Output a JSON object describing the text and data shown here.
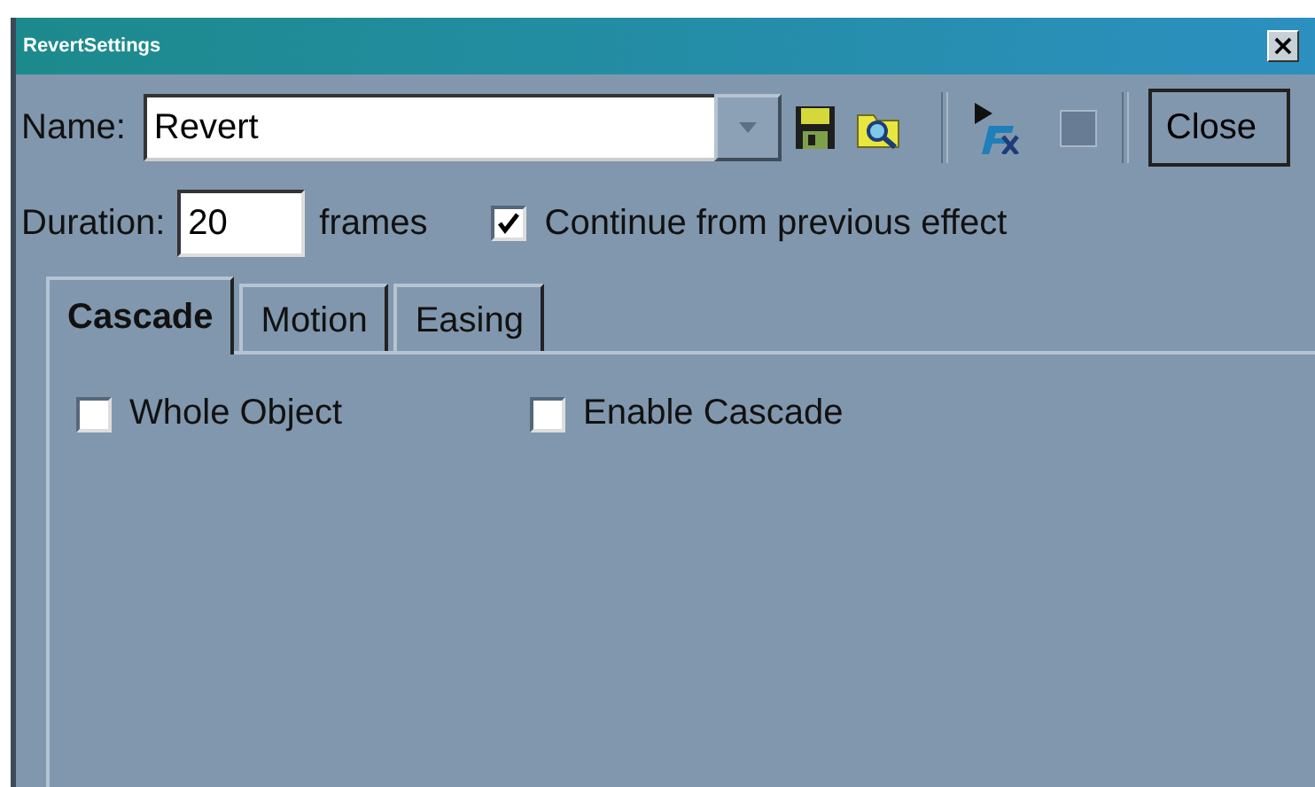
{
  "window": {
    "title": "RevertSettings",
    "close_glyph": "×"
  },
  "name_field": {
    "label": "Name:",
    "value": "Revert"
  },
  "toolbar": {
    "close_label": "Close"
  },
  "duration": {
    "label": "Duration:",
    "value": "20",
    "unit": "frames"
  },
  "continue_option": {
    "label": "Continue from previous effect",
    "checked": true
  },
  "tabs": [
    {
      "label": "Cascade",
      "selected": true
    },
    {
      "label": "Motion",
      "selected": false
    },
    {
      "label": "Easing",
      "selected": false
    }
  ],
  "cascade_options": [
    {
      "label": "Whole Object",
      "checked": false
    },
    {
      "label": "Enable Cascade",
      "checked": false
    }
  ]
}
